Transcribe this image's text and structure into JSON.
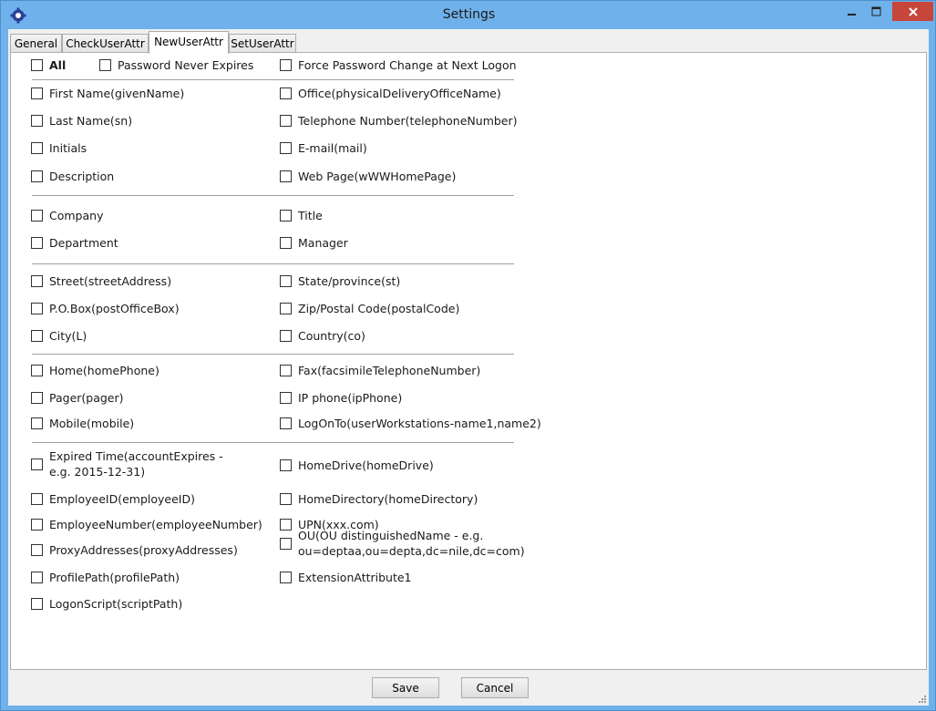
{
  "window": {
    "title": "Settings",
    "controls": [
      "minimize-icon",
      "maximize-icon",
      "close-icon"
    ],
    "accent_color": "#6fb1ea",
    "close_color": "#c7463a"
  },
  "tabs": [
    {
      "label": "General",
      "active": false
    },
    {
      "label": "CheckUserAttr",
      "active": false
    },
    {
      "label": "NewUserAttr",
      "active": true
    },
    {
      "label": "SetUserAttr",
      "active": false
    }
  ],
  "options": {
    "all": "All",
    "password_never_expires": "Password Never Expires",
    "force_password_change": "Force Password Change at Next Logon"
  },
  "attributes": {
    "first_name": "First Name(givenName)",
    "office": "Office(physicalDeliveryOfficeName)",
    "last_name": "Last Name(sn)",
    "telephone": "Telephone Number(telephoneNumber)",
    "initials": "Initials",
    "email": "E-mail(mail)",
    "description": "Description",
    "web_page": "Web Page(wWWHomePage)",
    "company": "Company",
    "title": "Title",
    "department": "Department",
    "manager": "Manager",
    "street": "Street(streetAddress)",
    "state": "State/province(st)",
    "po_box": "P.O.Box(postOfficeBox)",
    "zip": "Zip/Postal Code(postalCode)",
    "city": "City(L)",
    "country": "Country(co)",
    "home_phone": "Home(homePhone)",
    "fax": "Fax(facsimileTelephoneNumber)",
    "pager": "Pager(pager)",
    "ip_phone": "IP phone(ipPhone)",
    "mobile": "Mobile(mobile)",
    "logon_to": "LogOnTo(userWorkstations-name1,name2)",
    "expired_time": "Expired Time(accountExpires - e.g. 2015-12-31)",
    "home_drive": "HomeDrive(homeDrive)",
    "employee_id": "EmployeeID(employeeID)",
    "home_directory": "HomeDirectory(homeDirectory)",
    "employee_number": "EmployeeNumber(employeeNumber)",
    "upn": "UPN(xxx.com)",
    "proxy_addresses": "ProxyAddresses(proxyAddresses)",
    "ou": "OU(OU distinguishedName - e.g. ou=deptaa,ou=depta,dc=nile,dc=com)",
    "profile_path": "ProfilePath(profilePath)",
    "extension_attribute1": "ExtensionAttribute1",
    "logon_script": "LogonScript(scriptPath)"
  },
  "buttons": {
    "save": "Save",
    "cancel": "Cancel"
  }
}
